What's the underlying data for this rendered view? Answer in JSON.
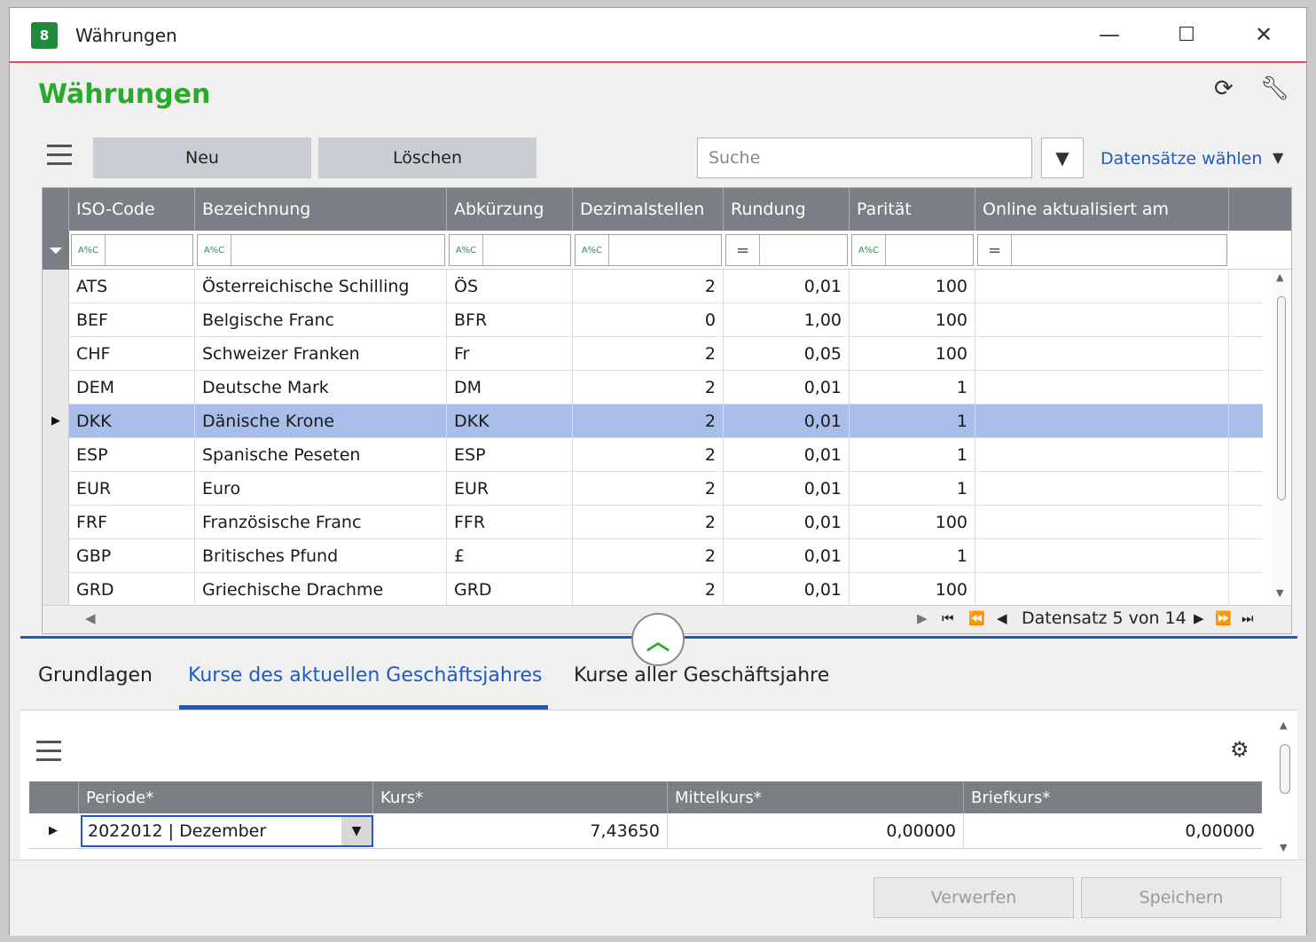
{
  "window": {
    "title": "Währungen",
    "minimize": "—",
    "maximize": "☐",
    "close": "✕"
  },
  "page": {
    "title": "Währungen"
  },
  "toolbar": {
    "new_label": "Neu",
    "delete_label": "Löschen",
    "search_placeholder": "Suche",
    "records_select_label": "Datensätze wählen"
  },
  "grid": {
    "columns": [
      "ISO-Code",
      "Bezeichnung",
      "Abkürzung",
      "Dezimalstellen",
      "Rundung",
      "Parität",
      "Online aktualisiert am"
    ],
    "filter_ops": [
      "A%C",
      "A%C",
      "A%C",
      "A%C",
      "=",
      "A%C",
      "="
    ],
    "rows": [
      {
        "iso": "ATS",
        "name": "Österreichische Schilling",
        "abbr": "ÖS",
        "dec": "2",
        "round": "0,01",
        "parity": "100",
        "updated": ""
      },
      {
        "iso": "BEF",
        "name": "Belgische Franc",
        "abbr": "BFR",
        "dec": "0",
        "round": "1,00",
        "parity": "100",
        "updated": ""
      },
      {
        "iso": "CHF",
        "name": "Schweizer Franken",
        "abbr": "Fr",
        "dec": "2",
        "round": "0,05",
        "parity": "100",
        "updated": ""
      },
      {
        "iso": "DEM",
        "name": "Deutsche Mark",
        "abbr": "DM",
        "dec": "2",
        "round": "0,01",
        "parity": "1",
        "updated": ""
      },
      {
        "iso": "DKK",
        "name": "Dänische Krone",
        "abbr": "DKK",
        "dec": "2",
        "round": "0,01",
        "parity": "1",
        "updated": ""
      },
      {
        "iso": "ESP",
        "name": "Spanische Peseten",
        "abbr": "ESP",
        "dec": "2",
        "round": "0,01",
        "parity": "1",
        "updated": ""
      },
      {
        "iso": "EUR",
        "name": "Euro",
        "abbr": "EUR",
        "dec": "2",
        "round": "0,01",
        "parity": "1",
        "updated": ""
      },
      {
        "iso": "FRF",
        "name": "Französische Franc",
        "abbr": "FFR",
        "dec": "2",
        "round": "0,01",
        "parity": "100",
        "updated": ""
      },
      {
        "iso": "GBP",
        "name": "Britisches Pfund",
        "abbr": "£",
        "dec": "2",
        "round": "0,01",
        "parity": "1",
        "updated": ""
      },
      {
        "iso": "GRD",
        "name": "Griechische Drachme",
        "abbr": "GRD",
        "dec": "2",
        "round": "0,01",
        "parity": "100",
        "updated": ""
      }
    ],
    "selected_row": "DKK",
    "pager_text": "Datensatz 5 von 14"
  },
  "tabs": [
    {
      "label": "Grundlagen",
      "active": false
    },
    {
      "label": "Kurse des aktuellen Geschäftsjahres",
      "active": true
    },
    {
      "label": "Kurse aller Geschäftsjahre",
      "active": false
    }
  ],
  "rates_grid": {
    "columns": [
      "Periode*",
      "Kurs*",
      "Mittelkurs*",
      "Briefkurs*"
    ],
    "row": {
      "period": "2022012 | Dezember",
      "rate": "7,43650",
      "mid": "0,00000",
      "ask": "0,00000"
    }
  },
  "footer": {
    "discard_label": "Verwerfen",
    "save_label": "Speichern"
  },
  "colors": {
    "accent": "#1f5bbd",
    "title_green": "#2aaa2a",
    "header_gray": "#7b7e84",
    "selection": "#a9bde8"
  }
}
